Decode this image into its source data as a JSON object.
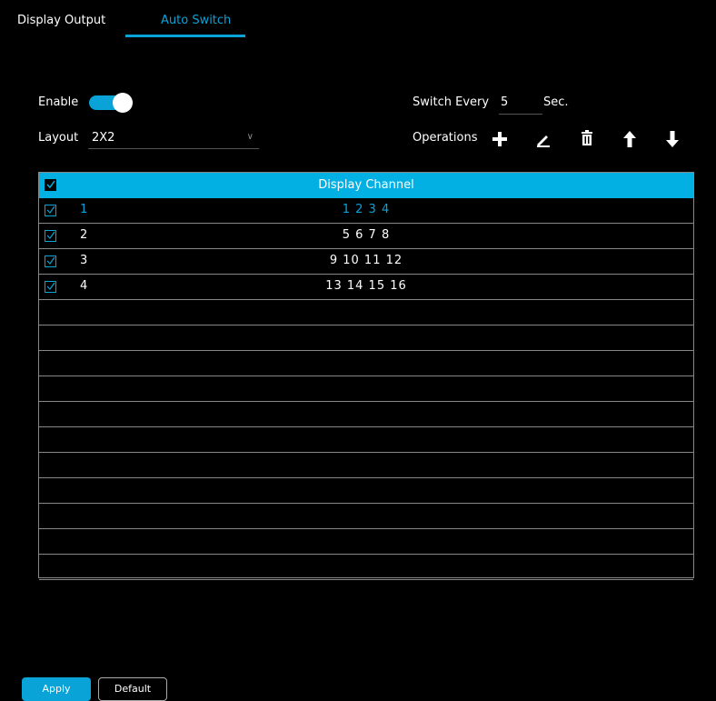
{
  "tabs": [
    {
      "label": "Display Output",
      "active": false
    },
    {
      "label": "Auto Switch",
      "active": true
    }
  ],
  "enable": {
    "label": "Enable",
    "on": true
  },
  "layout": {
    "label": "Layout",
    "value": "2X2"
  },
  "switch_every": {
    "label": "Switch Every",
    "value": "5",
    "unit": "Sec."
  },
  "operations": {
    "label": "Operations",
    "icons": [
      "add-icon",
      "edit-icon",
      "delete-icon",
      "move-up-icon",
      "move-down-icon"
    ]
  },
  "table": {
    "header": "Display Channel",
    "rows": [
      {
        "num": "1",
        "channels": "1 2 3 4",
        "checked": true
      },
      {
        "num": "2",
        "channels": "5 6 7 8",
        "checked": true
      },
      {
        "num": "3",
        "channels": "9 10 11 12",
        "checked": true
      },
      {
        "num": "4",
        "channels": "13 14 15 16",
        "checked": true
      },
      {
        "num": "",
        "channels": "",
        "checked": false
      },
      {
        "num": "",
        "channels": "",
        "checked": false
      },
      {
        "num": "",
        "channels": "",
        "checked": false
      },
      {
        "num": "",
        "channels": "",
        "checked": false
      },
      {
        "num": "",
        "channels": "",
        "checked": false
      },
      {
        "num": "",
        "channels": "",
        "checked": false
      },
      {
        "num": "",
        "channels": "",
        "checked": false
      },
      {
        "num": "",
        "channels": "",
        "checked": false
      },
      {
        "num": "",
        "channels": "",
        "checked": false
      },
      {
        "num": "",
        "channels": "",
        "checked": false
      },
      {
        "num": "",
        "channels": "",
        "checked": false
      }
    ]
  },
  "buttons": {
    "apply": "Apply",
    "default": "Default"
  },
  "colors": {
    "accent": "#0aa3d8",
    "header": "#03b0e4",
    "background": "#000000"
  }
}
